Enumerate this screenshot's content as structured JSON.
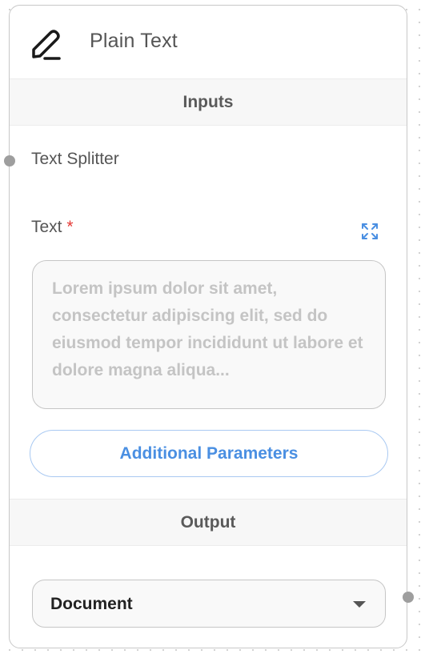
{
  "node": {
    "title": "Plain Text",
    "icon": "pencil-icon"
  },
  "inputs": {
    "section_label": "Inputs",
    "text_splitter_label": "Text Splitter",
    "text_label": "Text",
    "required_marker": "*",
    "text_placeholder": "Lorem ipsum dolor sit amet, consectetur adipiscing elit, sed do eiusmod tempor incididunt ut labore et dolore magna aliqua...",
    "expand_icon": "expand-icon",
    "additional_parameters_label": "Additional Parameters"
  },
  "output": {
    "section_label": "Output",
    "selected": "Document"
  },
  "colors": {
    "accent": "#4a8fe2",
    "required": "#e53935",
    "handle": "#9e9e9e"
  }
}
